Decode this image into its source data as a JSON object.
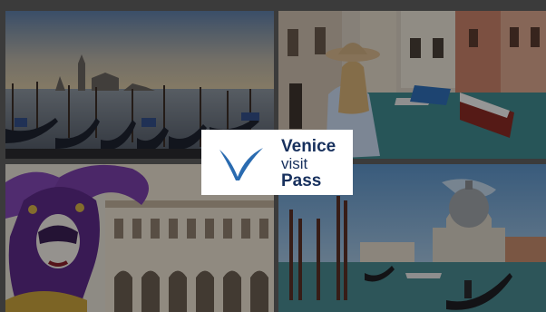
{
  "gallery": {
    "tiles": [
      {
        "icon": "venice-skyline-gondolas-photo"
      },
      {
        "icon": "woman-with-hat-canal-photo"
      },
      {
        "icon": "carnival-mask-doges-palace-photo"
      },
      {
        "icon": "grand-canal-basilica-photo"
      }
    ]
  },
  "logo": {
    "line1": "Venice",
    "line2": "visit",
    "line3": "Pass",
    "mark_icon": "checkmark-wave-icon",
    "colors": {
      "mark": "#2a6bb0",
      "text": "#17305d",
      "card": "#ffffff"
    }
  },
  "overlay": {
    "color": "#000000",
    "opacity": 0.38
  }
}
